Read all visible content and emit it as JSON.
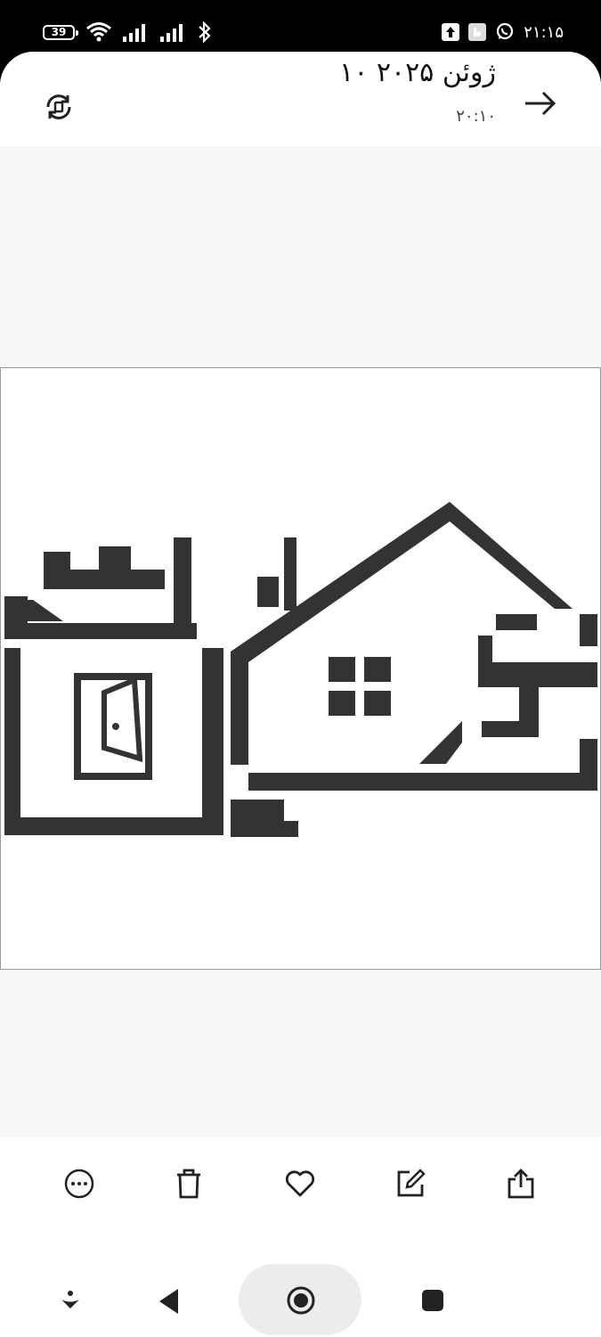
{
  "status_bar": {
    "battery": "39",
    "time": "۲۱:۱۵"
  },
  "header": {
    "date": "۱۰ ژوئن ۲۰۲۵",
    "time": "۲۰:۱۰"
  },
  "icons": {
    "battery": "battery-icon",
    "wifi": "wifi-icon",
    "signal": "signal-icon",
    "bluetooth": "bluetooth-icon",
    "upload": "upload-notification-icon",
    "app": "app-notification-icon",
    "whatsapp": "whatsapp-icon",
    "back": "arrow-right-icon",
    "rotate": "rotate-icon",
    "more": "more-icon",
    "delete": "trash-icon",
    "favorite": "heart-icon",
    "edit": "edit-icon",
    "share": "share-icon"
  },
  "colors": {
    "logo": "#333333",
    "viewer_bg": "#f8f8f8",
    "pill": "#ececec"
  }
}
